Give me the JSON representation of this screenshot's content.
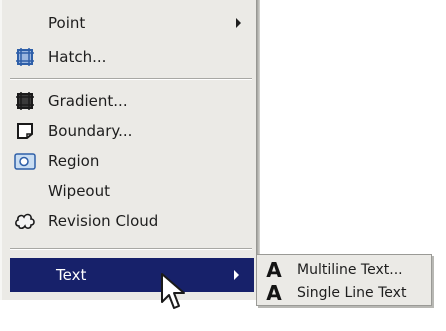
{
  "menu": {
    "items": [
      {
        "label": "Point",
        "icon": "none",
        "has_submenu": true
      },
      {
        "label": "Hatch...",
        "icon": "hatch-icon"
      },
      {
        "label": "Gradient...",
        "icon": "gradient-icon"
      },
      {
        "label": "Boundary...",
        "icon": "boundary-icon"
      },
      {
        "label": "Region",
        "icon": "region-icon"
      },
      {
        "label": "Wipeout",
        "icon": "none"
      },
      {
        "label": "Revision Cloud",
        "icon": "revision-cloud-icon"
      },
      {
        "label": "Text",
        "icon": "none",
        "has_submenu": true,
        "highlighted": true
      }
    ]
  },
  "submenu": {
    "items": [
      {
        "label": "Multiline Text...",
        "glyph": "A",
        "icon": "multiline-text-icon"
      },
      {
        "label": "Single Line Text",
        "glyph": "A",
        "icon": "single-line-text-icon"
      }
    ]
  },
  "colors": {
    "menu_bg": "#ebeae6",
    "highlight": "#17216a",
    "highlight_text": "#ffffff",
    "icon_blue": "#2e5fa8"
  }
}
